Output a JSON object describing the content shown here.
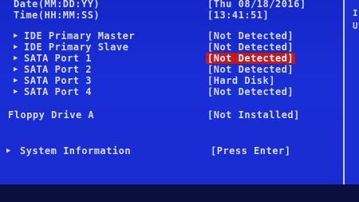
{
  "date": {
    "label": "Date(MM:DD:YY)",
    "value": "[Thu 08/18/2016]"
  },
  "time": {
    "label": "Time(HH:MM:SS)",
    "value": "[13:41:51]"
  },
  "drives": [
    {
      "label": "IDE Primary Master",
      "value": "[Not Detected]",
      "selected": false
    },
    {
      "label": "IDE Primary Slave",
      "value": "[Not Detected]",
      "selected": false
    },
    {
      "label": "SATA Port 1",
      "value": "[Not Detected]",
      "selected": true
    },
    {
      "label": "SATA Port 2",
      "value": "[Not Detected]",
      "selected": false
    },
    {
      "label": "SATA Port 3",
      "value": "[Hard Disk]",
      "selected": false
    },
    {
      "label": "SATA Port 4",
      "value": "[Not Detected]",
      "selected": false
    }
  ],
  "floppy": {
    "label": "Floppy Drive A",
    "value": "[Not Installed]"
  },
  "system_info": {
    "label": "System Information",
    "value": "[Press Enter]"
  },
  "right_panel": {
    "frag1": "I",
    "frag2": "U"
  },
  "colors": {
    "background": "#1a2ed6",
    "highlight": "#c21a1a",
    "text": "#d7dcf2"
  },
  "icons": {
    "submenu_arrow": "triangle-right-icon"
  }
}
